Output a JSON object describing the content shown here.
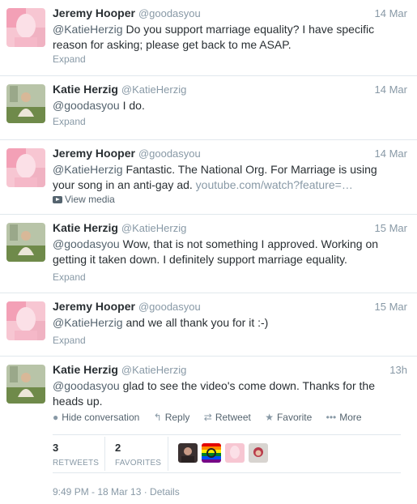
{
  "tweets": [
    {
      "name": "Jeremy Hooper",
      "handle": "@goodasyou",
      "time": "14 Mar",
      "mention": "@KatieHerzig",
      "text_line1": " Do you support marriage equality?  I have specific",
      "text_line2": "reason for asking; please get back to me ASAP.",
      "expand": "Expand",
      "avatar": "jeremy-avatar"
    },
    {
      "name": "Katie Herzig",
      "handle": "@KatieHerzig",
      "time": "14 Mar",
      "mention": "@goodasyou",
      "text_line1": " I do.",
      "expand": "Expand",
      "avatar": "katie-avatar"
    },
    {
      "name": "Jeremy Hooper",
      "handle": "@goodasyou",
      "time": "14 Mar",
      "mention": "@KatieHerzig",
      "text_line1": " Fantastic.  The National Org. For Marriage is using",
      "text_line2": "your song in an anti-gay ad. ",
      "link": "youtube.com/watch?feature=…",
      "media": "View media",
      "avatar": "jeremy-avatar"
    },
    {
      "name": "Katie Herzig",
      "handle": "@KatieHerzig",
      "time": "15 Mar",
      "mention": "@goodasyou",
      "text_line1": " Wow, that is not something I approved. Working on",
      "text_line2": "getting it taken down. I definitely support marriage equality.",
      "expand": "Expand",
      "avatar": "katie-avatar"
    },
    {
      "name": "Jeremy Hooper",
      "handle": "@goodasyou",
      "time": "15 Mar",
      "mention": "@KatieHerzig",
      "text_line1": " and we all thank you for it :-)",
      "expand": "Expand",
      "avatar": "jeremy-avatar"
    },
    {
      "name": "Katie Herzig",
      "handle": "@KatieHerzig",
      "time": "13h",
      "mention": "@goodasyou",
      "text_line1": " glad to see the video's come down. Thanks for the",
      "text_line2": "heads up.",
      "avatar": "katie-avatar"
    }
  ],
  "actions": {
    "hide": "Hide conversation",
    "reply": "Reply",
    "retweet": "Retweet",
    "favorite": "Favorite",
    "more": "More"
  },
  "stats": {
    "retweets_count": "3",
    "retweets_label": "RETWEETS",
    "favorites_count": "2",
    "favorites_label": "FAVORITES"
  },
  "footer": "9:49 PM - 18 Mar 13 · Details",
  "colors": {
    "text": "#292f33",
    "muted": "#8899a6",
    "border": "#e1e8ed",
    "jeremy_avatar": "#f0a8b8",
    "katie_avatar": "#8a9a6a"
  }
}
